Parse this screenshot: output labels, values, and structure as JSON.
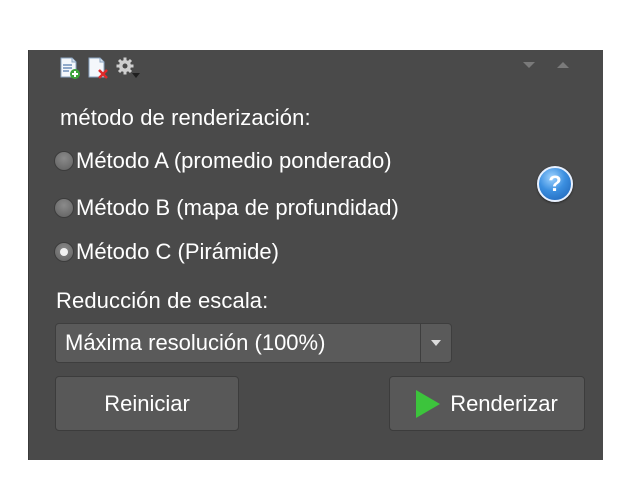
{
  "toolbar": {
    "icons": [
      "add-document-icon",
      "remove-document-icon",
      "gear-menu-icon"
    ],
    "corner_controls": [
      "collapse-down-icon",
      "collapse-up-icon"
    ]
  },
  "method": {
    "title": "método de renderización:",
    "options": [
      {
        "label": "Método A (promedio ponderado)",
        "checked": false
      },
      {
        "label": "Método B (mapa de profundidad)",
        "checked": false
      },
      {
        "label": "Método C (Pirámide)",
        "checked": true
      }
    ],
    "help_symbol": "?"
  },
  "scale": {
    "title": "Reducción de escala:",
    "selected": "Máxima resolución (100%)"
  },
  "buttons": {
    "reset_label": "Reiniciar",
    "render_label": "Renderizar"
  },
  "colors": {
    "panel": "#4a4a4a",
    "accent_play": "#3cc43c",
    "help": "#3b8fe0"
  }
}
